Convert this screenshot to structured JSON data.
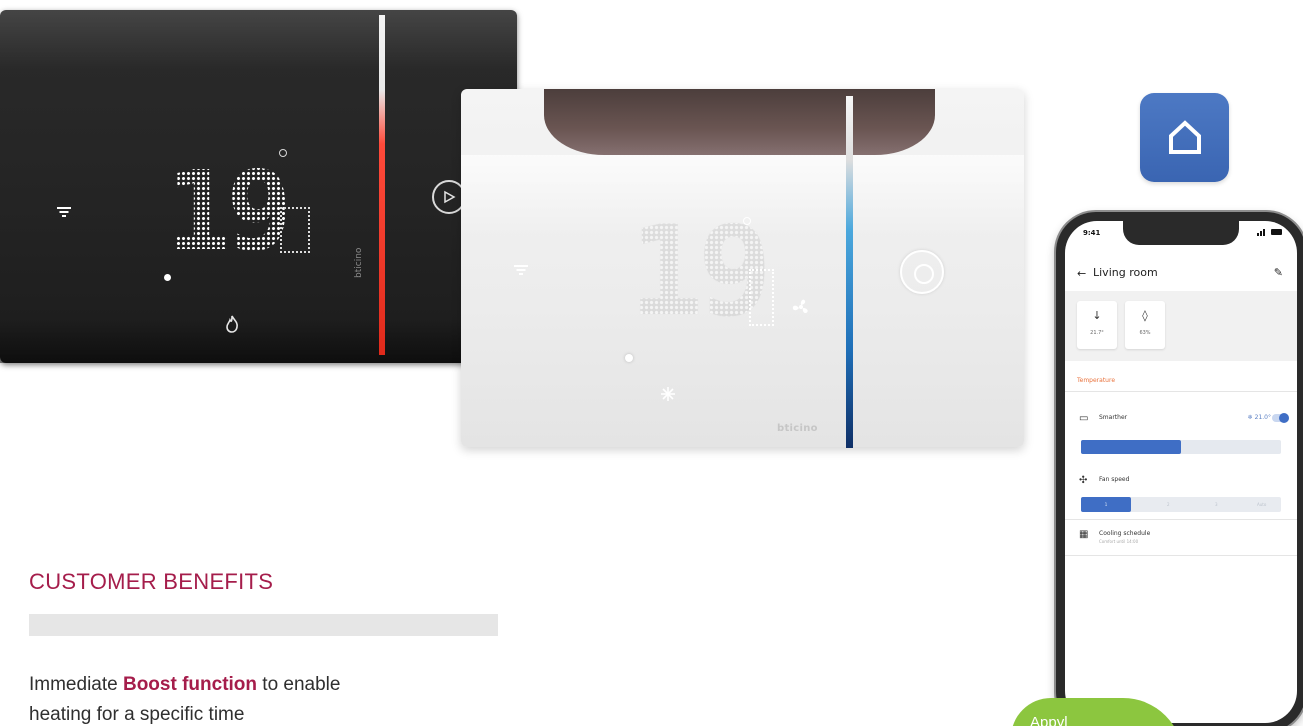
{
  "thermostat_black": {
    "temperature": "19",
    "brand": "bticino"
  },
  "thermostat_white": {
    "temperature": "19",
    "brand": "bticino"
  },
  "phone_app": {
    "status_time": "9:41",
    "room_title": "Living room",
    "tiles": [
      {
        "icon": "thermometer-icon",
        "value": "21.7°"
      },
      {
        "icon": "humidity-icon",
        "value": "63%"
      }
    ],
    "section_title": "Temperature",
    "device_label": "Smarther",
    "device_setpoint": "21.0°",
    "slider_level": 0.5,
    "fan_label": "Fan speed",
    "schedule_label": "Cooling schedule",
    "schedule_sub": "Comfort until 14:00"
  },
  "colors": {
    "accent": "#a51d4b",
    "app_blue": "#3f6ec5",
    "badge_green": "#8cc63f"
  },
  "benefits": {
    "title": "CUSTOMER BENEFITS",
    "line_prefix": "Immediate ",
    "line_bold": "Boost function",
    "line_suffix": " to enable",
    "line2": "heating for a specific time"
  },
  "badge": {
    "text": "Appyl"
  }
}
